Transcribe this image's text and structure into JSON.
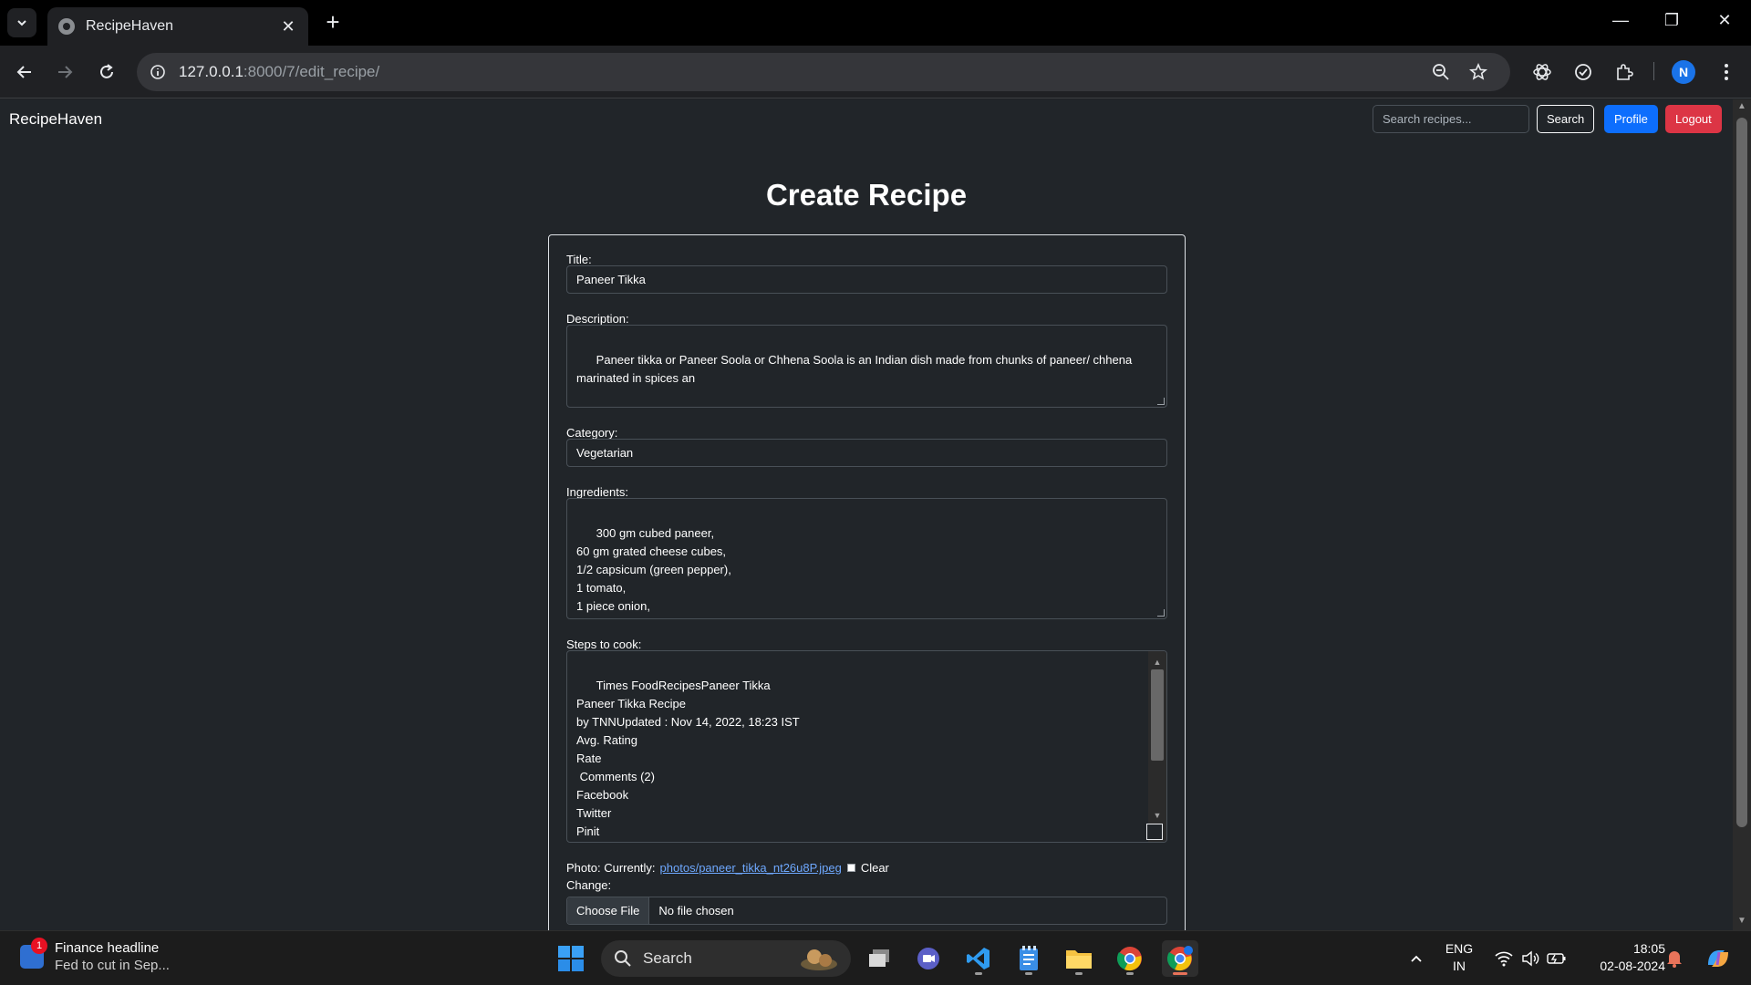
{
  "browser": {
    "tab_title": "RecipeHaven",
    "url_host": "127.0.0.1",
    "url_rest": ":8000/7/edit_recipe/",
    "profile_initial": "N"
  },
  "navbar": {
    "brand": "RecipeHaven",
    "search_placeholder": "Search recipes...",
    "search_label": "Search",
    "profile_label": "Profile",
    "logout_label": "Logout"
  },
  "form": {
    "heading": "Create Recipe",
    "title_label": "Title:",
    "title_value": "Paneer Tikka",
    "description_label": "Description:",
    "description_value": "Paneer tikka or Paneer Soola or Chhena Soola is an Indian dish made from chunks of paneer/ chhena\nmarinated in spices an",
    "category_label": "Category:",
    "category_value": "Vegetarian",
    "ingredients_label": "Ingredients:",
    "ingredients_value": "300 gm cubed paneer,\n60 gm grated cheese cubes,\n1/2 capsicum (green pepper),\n1 tomato,\n1 piece onion,",
    "steps_label": "Steps to cook:",
    "steps_value": "Times FoodRecipesPaneer Tikka\nPaneer Tikka Recipe\nby TNNUpdated : Nov 14, 2022, 18:23 IST\nAvg. Rating\nRate\n Comments (2)\nFacebook\nTwitter\nPinit\nPaneer Tikka",
    "photo_label": "Photo: Currently:",
    "photo_link": "photos/paneer_tikka_nt26u8P.jpeg",
    "clear_label": "Clear",
    "change_label": "Change:",
    "choose_file_label": "Choose File",
    "file_status": "No file chosen"
  },
  "taskbar": {
    "news_badge": "1",
    "news_title": "Finance headline",
    "news_subtitle": "Fed to cut in Sep...",
    "search_label": "Search",
    "lang_top": "ENG",
    "lang_bottom": "IN",
    "time": "18:05",
    "date": "02-08-2024"
  }
}
